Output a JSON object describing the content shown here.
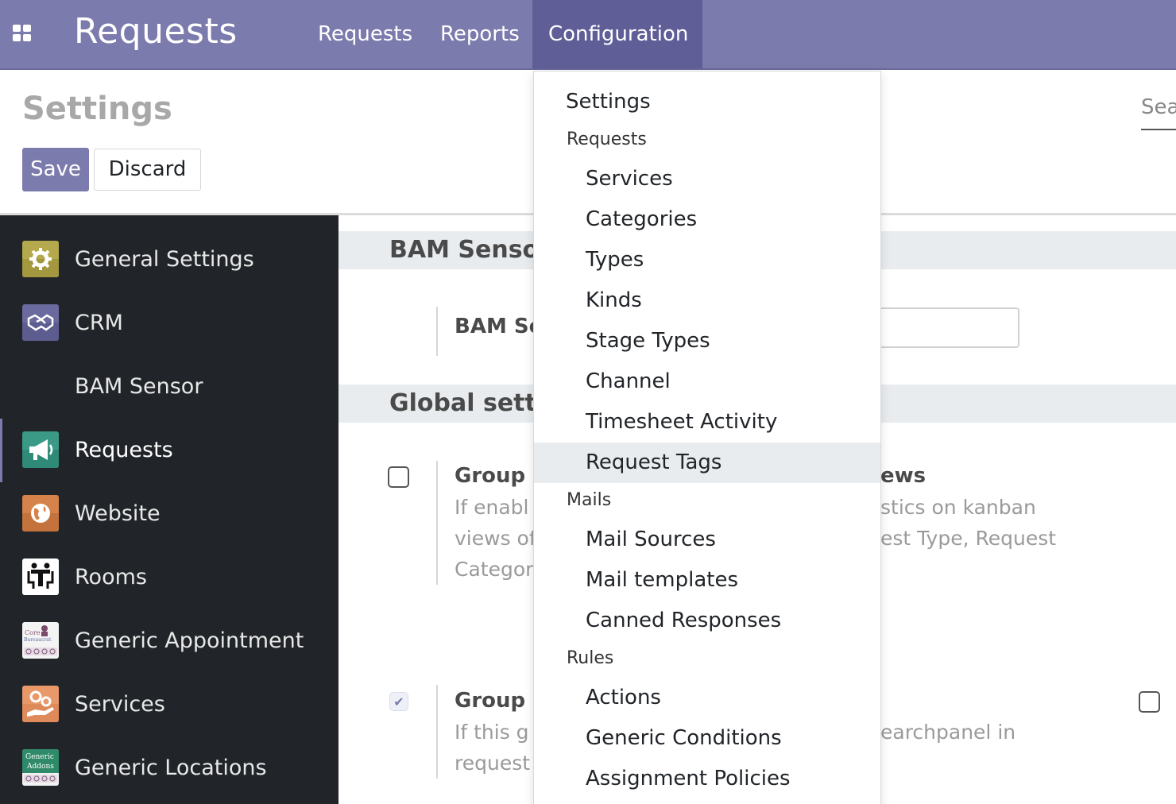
{
  "navbar": {
    "brand": "Requests",
    "menu": [
      {
        "label": "Requests",
        "active": false
      },
      {
        "label": "Reports",
        "active": false
      },
      {
        "label": "Configuration",
        "active": true
      }
    ],
    "color": "#7c7bad"
  },
  "control_panel": {
    "title": "Settings",
    "save_label": "Save",
    "discard_label": "Discard",
    "search_fragment": "Sea"
  },
  "sidebar": {
    "items": [
      {
        "label": "General Settings",
        "icon": "gear-icon"
      },
      {
        "label": "CRM",
        "icon": "handshake-icon"
      },
      {
        "label": "BAM Sensor",
        "icon": ""
      },
      {
        "label": "Requests",
        "icon": "megaphone-icon",
        "active": true
      },
      {
        "label": "Website",
        "icon": "globe-icon"
      },
      {
        "label": "Rooms",
        "icon": "meeting-room-icon"
      },
      {
        "label": "Generic Appointment",
        "icon": "core-bureaucrat-icon"
      },
      {
        "label": "Services",
        "icon": "services-cogs-icon"
      },
      {
        "label": "Generic Locations",
        "icon": "generic-addons-icon"
      }
    ]
  },
  "main": {
    "section_bam": "BAM Sensor",
    "bam_setting_label": "BAM Se",
    "section_global": "Global setti",
    "setting1": {
      "title_left": "Group F",
      "title_right": "ews",
      "desc_left": [
        "If enabl",
        "views of",
        "Categor"
      ],
      "desc_right": [
        "stics on kanban",
        "est Type, Request"
      ],
      "checked": false
    },
    "setting2": {
      "title_left": "Group F",
      "desc_left": [
        "If this g",
        "request"
      ],
      "desc_right": [
        "earchpanel in"
      ],
      "checked": true
    },
    "setting3_checked": false
  },
  "dropdown": {
    "items": [
      {
        "kind": "item",
        "level": 0,
        "label": "Settings"
      },
      {
        "kind": "header",
        "label": "Requests"
      },
      {
        "kind": "item",
        "level": 1,
        "label": "Services"
      },
      {
        "kind": "item",
        "level": 1,
        "label": "Categories"
      },
      {
        "kind": "item",
        "level": 1,
        "label": "Types"
      },
      {
        "kind": "item",
        "level": 1,
        "label": "Kinds"
      },
      {
        "kind": "item",
        "level": 1,
        "label": "Stage Types"
      },
      {
        "kind": "item",
        "level": 1,
        "label": "Channel"
      },
      {
        "kind": "item",
        "level": 1,
        "label": "Timesheet Activity"
      },
      {
        "kind": "item",
        "level": 1,
        "label": "Request Tags",
        "hover": true
      },
      {
        "kind": "header",
        "label": "Mails"
      },
      {
        "kind": "item",
        "level": 1,
        "label": "Mail Sources"
      },
      {
        "kind": "item",
        "level": 1,
        "label": "Mail templates"
      },
      {
        "kind": "item",
        "level": 1,
        "label": "Canned Responses"
      },
      {
        "kind": "header",
        "label": "Rules"
      },
      {
        "kind": "item",
        "level": 1,
        "label": "Actions"
      },
      {
        "kind": "item",
        "level": 1,
        "label": "Generic Conditions"
      },
      {
        "kind": "item",
        "level": 1,
        "label": "Assignment Policies"
      }
    ]
  }
}
